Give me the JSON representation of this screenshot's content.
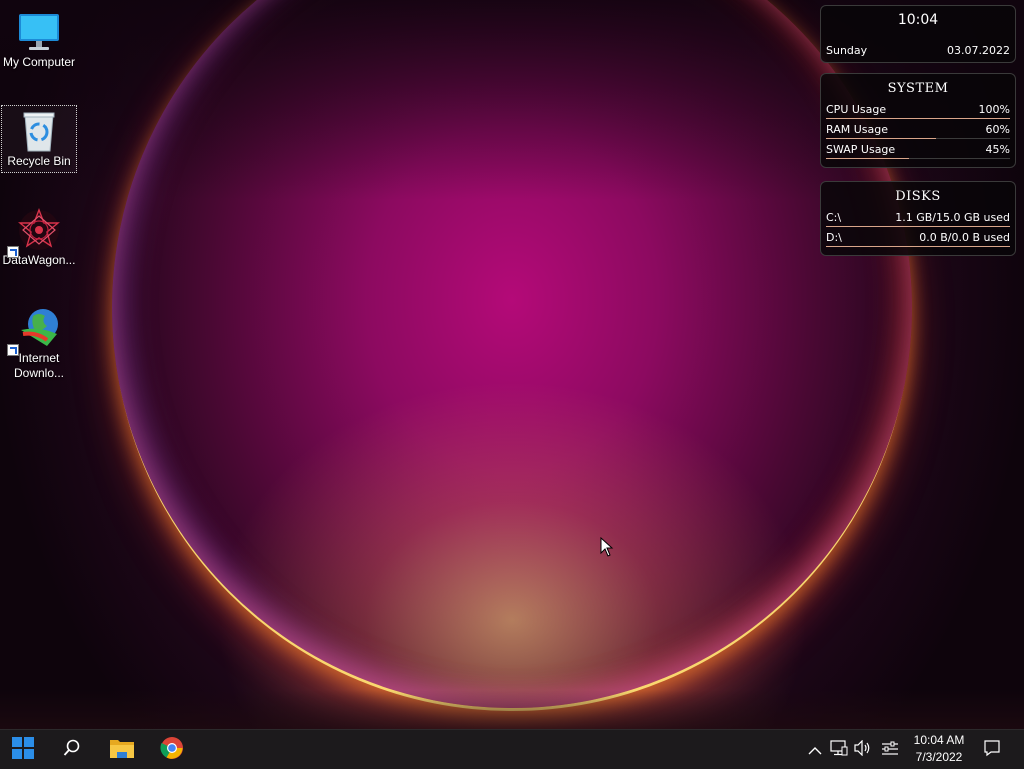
{
  "desktop": {
    "icons": [
      {
        "label": "My Computer"
      },
      {
        "label": "Recycle Bin"
      },
      {
        "label": "DataWagon..."
      },
      {
        "label": "Internet Downlo..."
      }
    ]
  },
  "clock_widget": {
    "time": "10:04",
    "day": "Sunday",
    "date": "03.07.2022"
  },
  "system_widget": {
    "title": "SYSTEM",
    "rows": [
      {
        "label": "CPU Usage",
        "value": "100%",
        "fraction": 1.0
      },
      {
        "label": "RAM Usage",
        "value": "60%",
        "fraction": 0.6
      },
      {
        "label": "SWAP Usage",
        "value": "45%",
        "fraction": 0.45
      }
    ]
  },
  "disks_widget": {
    "title": "DISKS",
    "rows": [
      {
        "label": "C:\\",
        "value": "1.1 GB/15.0 GB used",
        "fraction": 1.0
      },
      {
        "label": "D:\\",
        "value": "0.0 B/0.0 B used",
        "fraction": 1.0
      }
    ]
  },
  "taskbar": {
    "items": [
      {
        "icon": "windows-start-icon"
      },
      {
        "icon": "search-icon"
      },
      {
        "icon": "file-explorer-icon"
      },
      {
        "icon": "chrome-icon"
      }
    ],
    "tray": {
      "icons": [
        "chevron-up-icon",
        "network-icon",
        "volume-icon",
        "pen-settings-icon"
      ],
      "time": "10:04 AM",
      "date": "7/3/2022"
    }
  },
  "colors": {
    "accent": "#d9a58a",
    "taskbar": "#1c1a1c",
    "start_blue": "#2b8ee8"
  }
}
